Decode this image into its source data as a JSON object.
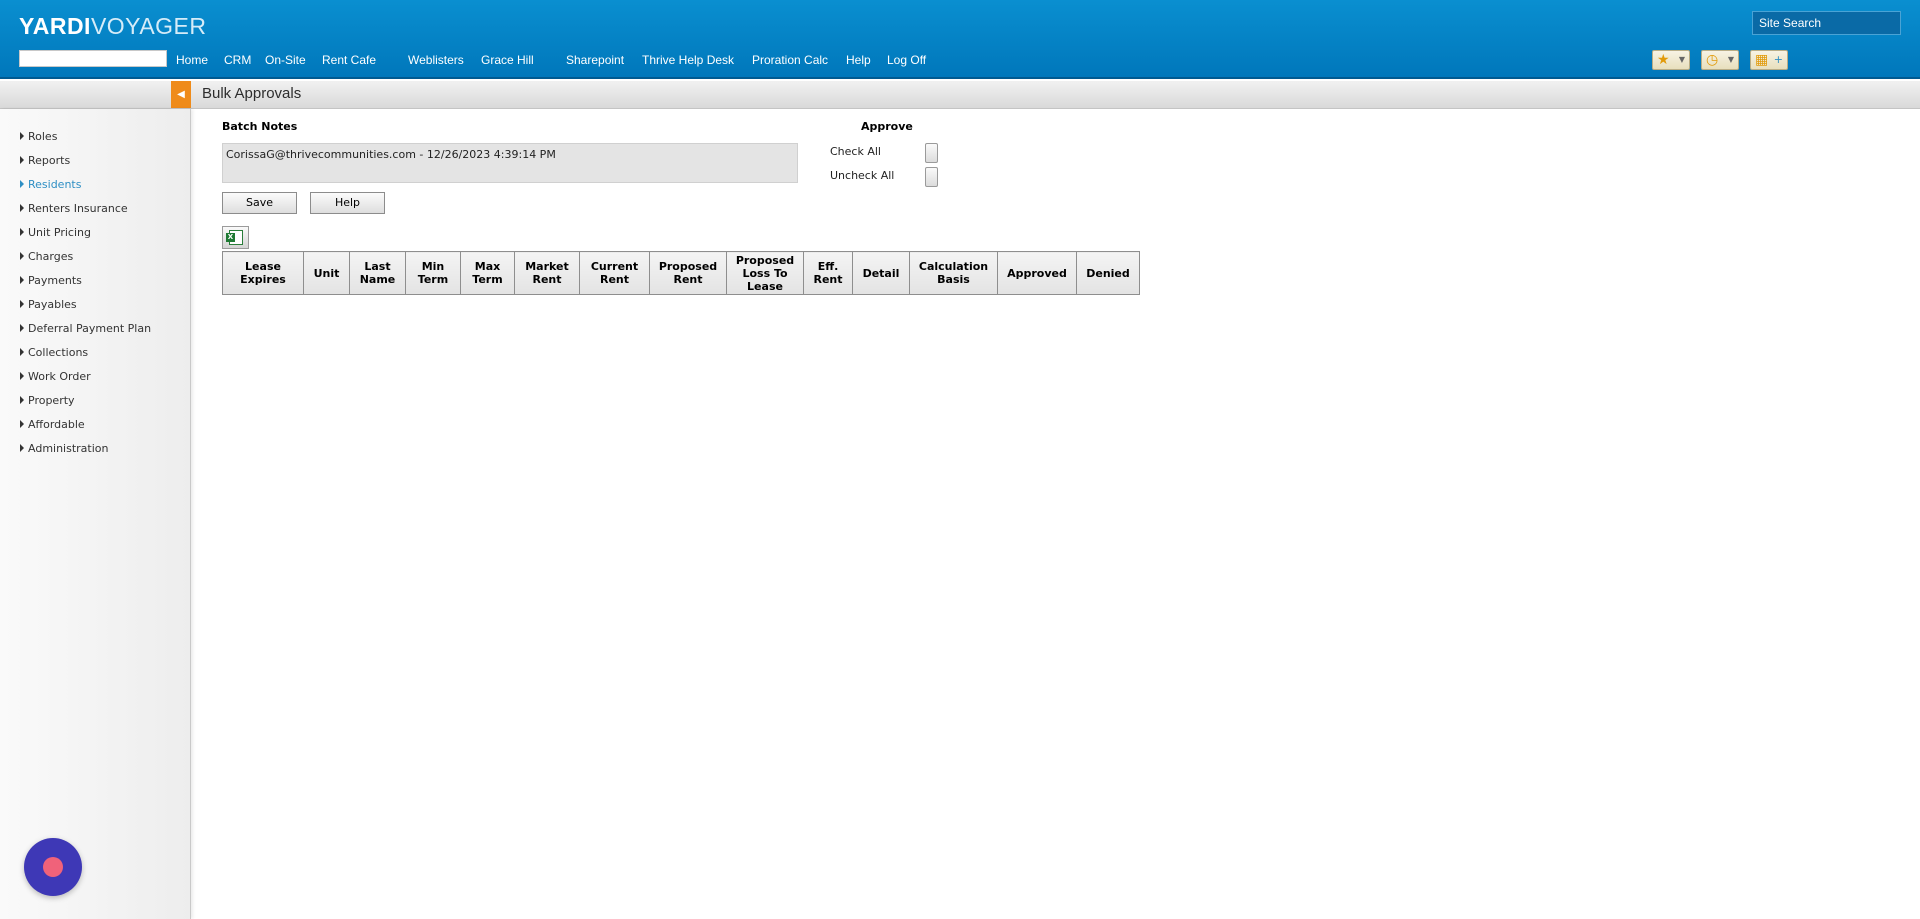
{
  "app": {
    "logo_bold": "YARDI",
    "logo_light": "VOYAGER"
  },
  "header": {
    "site_search": "Site Search",
    "nav": [
      "Home",
      "CRM",
      "On-Site",
      "Rent Cafe",
      "Weblisters",
      "Grace Hill",
      "Sharepoint",
      "Thrive Help Desk",
      "Proration Calc",
      "Help",
      "Log Off"
    ],
    "tools": [
      {
        "icon": "star-icon",
        "glyph": "★"
      },
      {
        "icon": "clock-icon",
        "glyph": "◷"
      },
      {
        "icon": "dashboard-icon",
        "glyph": "▦"
      }
    ]
  },
  "page": {
    "title": "Bulk Approvals"
  },
  "sidebar": {
    "items": [
      {
        "label": "Roles",
        "active": false
      },
      {
        "label": "Reports",
        "active": false
      },
      {
        "label": "Residents",
        "active": true
      },
      {
        "label": "Renters Insurance",
        "active": false
      },
      {
        "label": "Unit Pricing",
        "active": false
      },
      {
        "label": "Charges",
        "active": false
      },
      {
        "label": "Payments",
        "active": false
      },
      {
        "label": "Payables",
        "active": false
      },
      {
        "label": "Deferral Payment Plan",
        "active": false
      },
      {
        "label": "Collections",
        "active": false
      },
      {
        "label": "Work Order",
        "active": false
      },
      {
        "label": "Property",
        "active": false
      },
      {
        "label": "Affordable",
        "active": false
      },
      {
        "label": "Administration",
        "active": false
      }
    ]
  },
  "batch": {
    "notes_label": "Batch Notes",
    "notes_value": "CorissaG@thrivecommunities.com - 12/26/2023 4:39:14 PM",
    "save_label": "Save",
    "help_label": "Help"
  },
  "approve": {
    "label": "Approve",
    "check_all": "Check All",
    "uncheck_all": "Uncheck All"
  },
  "grid": {
    "columns": [
      [
        "Lease",
        "Expires"
      ],
      [
        "Unit"
      ],
      [
        "Last",
        "Name"
      ],
      [
        "Min",
        "Term"
      ],
      [
        "Max",
        "Term"
      ],
      [
        "Market",
        "Rent"
      ],
      [
        "Current",
        "Rent"
      ],
      [
        "Proposed",
        "Rent"
      ],
      [
        "Proposed",
        "Loss To",
        "Lease"
      ],
      [
        "Eff.",
        "Rent"
      ],
      [
        "Detail"
      ],
      [
        "Calculation",
        "Basis"
      ],
      [
        "Approved"
      ],
      [
        "Denied"
      ]
    ]
  }
}
